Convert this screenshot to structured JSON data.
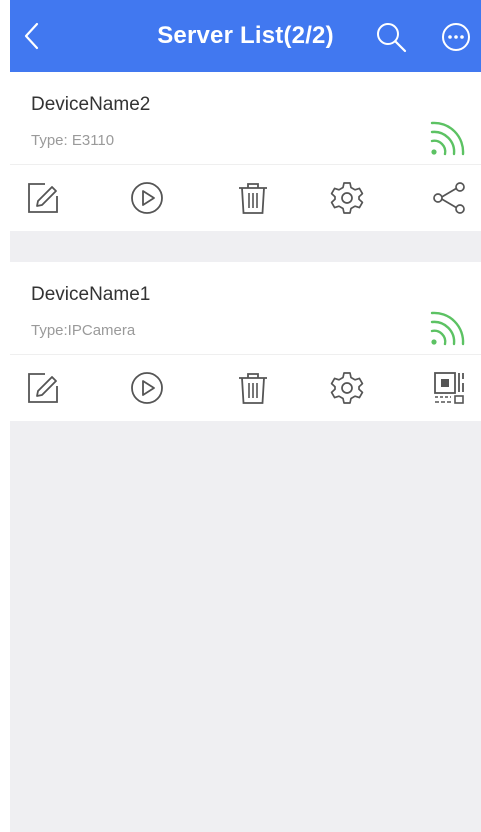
{
  "header": {
    "title": "Server List(2/2)",
    "background": "#4178f0",
    "back_icon": "chevron-left-icon",
    "search_icon": "search-icon",
    "more_icon": "more-icon"
  },
  "devices": [
    {
      "name": "DeviceName2",
      "type_label": "Type: E3110",
      "signal_icon": "signal-icon",
      "signal_color": "#5cc263",
      "actions": [
        "edit-icon",
        "play-icon",
        "delete-icon",
        "settings-icon",
        "share-icon"
      ]
    },
    {
      "name": "DeviceName1",
      "type_label": "Type:IPCamera",
      "signal_icon": "signal-icon",
      "signal_color": "#5cc263",
      "actions": [
        "edit-icon",
        "play-icon",
        "delete-icon",
        "settings-icon",
        "qr-code-icon"
      ]
    }
  ]
}
